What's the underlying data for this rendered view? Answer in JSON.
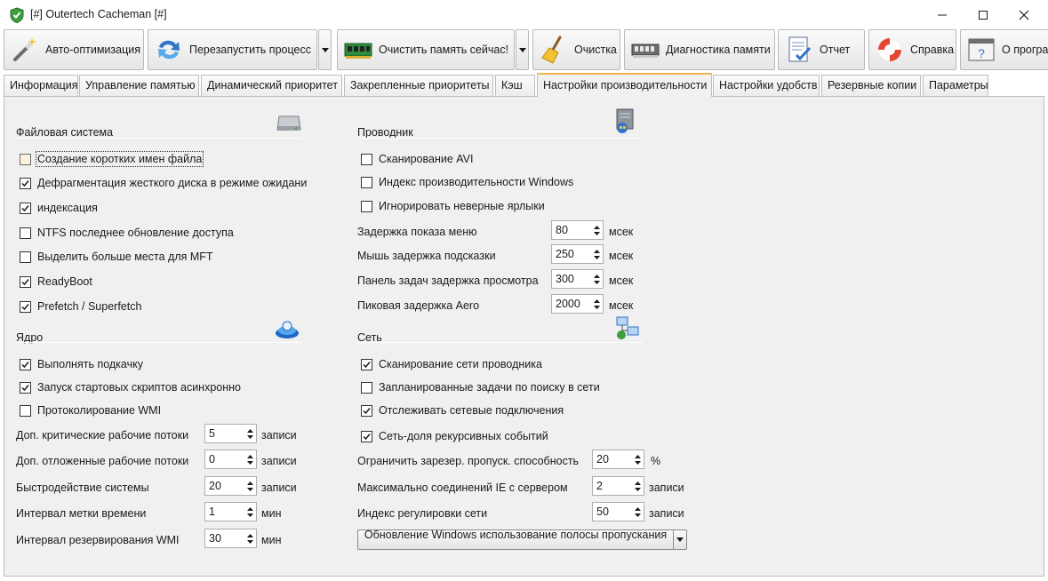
{
  "window": {
    "title": "[#] Outertech Cacheman [#]"
  },
  "toolbar": {
    "buttons": [
      {
        "label": "Авто-оптимизация",
        "icon": "magic-wand-icon"
      },
      {
        "label": "Перезапустить процесс",
        "icon": "restart-arrows-icon"
      },
      {
        "label": "Очистить память сейчас!",
        "icon": "memory-module-icon"
      },
      {
        "label": "Очистка",
        "icon": "broom-icon"
      },
      {
        "label": "Диагностика памяти",
        "icon": "memory-diagnostics-icon"
      },
      {
        "label": "Отчет",
        "icon": "report-icon"
      },
      {
        "label": "Справка",
        "icon": "lifebuoy-icon"
      },
      {
        "label": "О програ",
        "icon": "about-icon"
      }
    ]
  },
  "tabs": [
    "Информация",
    "Управление памятью",
    "Динамический приоритет",
    "Закрепленные приоритеты",
    "Кэш",
    "Настройки производительности",
    "Настройки удобств",
    "Резервные копии",
    "Параметры"
  ],
  "active_tab": "Настройки производительности",
  "filesystem": {
    "title": "Файловая система",
    "checkboxes": [
      {
        "label": "Создание коротких имен файла",
        "checked": false
      },
      {
        "label": "Дефрагментация жесткого диска в режиме ожидани",
        "checked": true
      },
      {
        "label": "индексация",
        "checked": true
      },
      {
        "label": "NTFS последнее обновление доступа",
        "checked": false
      },
      {
        "label": "Выделить больше места для MFT",
        "checked": false
      },
      {
        "label": "ReadyBoot",
        "checked": true
      },
      {
        "label": "Prefetch / Superfetch",
        "checked": true
      }
    ]
  },
  "kernel": {
    "title": "Ядро",
    "checkboxes": [
      {
        "label": "Выполнять подкачку",
        "checked": true
      },
      {
        "label": "Запуск стартовых скриптов асинхронно",
        "checked": true
      },
      {
        "label": "Протоколирование WMI",
        "checked": false
      }
    ],
    "fields": [
      {
        "label": "Доп. критические рабочие потоки",
        "value": "5",
        "unit": "записи"
      },
      {
        "label": "Доп. отложенные рабочие потоки",
        "value": "0",
        "unit": "записи"
      },
      {
        "label": "Быстродействие системы",
        "value": "20",
        "unit": "записи"
      },
      {
        "label": "Интервал метки времени",
        "value": "1",
        "unit": "мин"
      },
      {
        "label": "Интервал резервирования WMI",
        "value": "30",
        "unit": "мин"
      }
    ]
  },
  "explorer": {
    "title": "Проводник",
    "checkboxes": [
      {
        "label": "Сканирование AVI",
        "checked": false
      },
      {
        "label": "Индекс производительности Windows",
        "checked": false
      },
      {
        "label": "Игнорировать неверные ярлыки",
        "checked": false
      }
    ],
    "fields": [
      {
        "label": "Задержка показа меню",
        "value": "80",
        "unit": "мсек"
      },
      {
        "label": "Мышь задержка подсказки",
        "value": "250",
        "unit": "мсек"
      },
      {
        "label": "Панель задач задержка просмотра",
        "value": "300",
        "unit": "мсек"
      },
      {
        "label": "Пиковая задержка Aero",
        "value": "2000",
        "unit": "мсек"
      }
    ]
  },
  "network": {
    "title": "Сеть",
    "checkboxes": [
      {
        "label": "Сканирование сети проводника",
        "checked": true
      },
      {
        "label": "Запланированные задачи по поиску в сети",
        "checked": false
      },
      {
        "label": "Отслеживать сетевые подключения",
        "checked": true
      },
      {
        "label": "Сеть-доля рекурсивных событий",
        "checked": true
      }
    ],
    "fields": [
      {
        "label": "Ограничить зарезер. пропуск. способность",
        "value": "20",
        "unit": "%"
      },
      {
        "label": "Максимально соединений IE с сервером",
        "value": "2",
        "unit": "записи"
      },
      {
        "label": "Индекс регулировки сети",
        "value": "50",
        "unit": "записи"
      }
    ],
    "combo_value": "Обновление Windows использование полосы пропускания"
  },
  "colors": {
    "active_tab_accent": "#f0b948",
    "panel_bg": "#f0f0f0",
    "check": "#1a1a1a"
  }
}
